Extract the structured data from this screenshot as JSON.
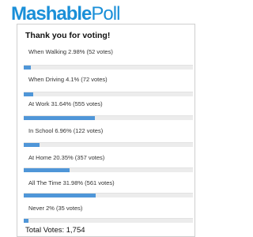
{
  "header": {
    "logo_primary": "Mashable",
    "logo_secondary": "Poll"
  },
  "poll": {
    "thanks": "Thank you for voting!",
    "options": [
      {
        "label": "When Walking  2.98%  (52 votes)",
        "percent": 2.98
      },
      {
        "label": "When Driving  4.1%  (72 votes)",
        "percent": 4.1
      },
      {
        "label": "At Work  31.64%  (555 votes)",
        "percent": 31.64
      },
      {
        "label": "In School  6.96%  (122 votes)",
        "percent": 6.96
      },
      {
        "label": "At Home  20.35%  (357 votes)",
        "percent": 20.35
      },
      {
        "label": "All The Time  31.98%  (561 votes)",
        "percent": 31.98
      },
      {
        "label": "Never  2%  (35 votes)",
        "percent": 2
      }
    ],
    "total": "Total Votes: 1,754"
  },
  "colors": {
    "brand": "#1a8fd8",
    "bar_fill": "#4f96d8",
    "bar_track": "#ececec"
  }
}
